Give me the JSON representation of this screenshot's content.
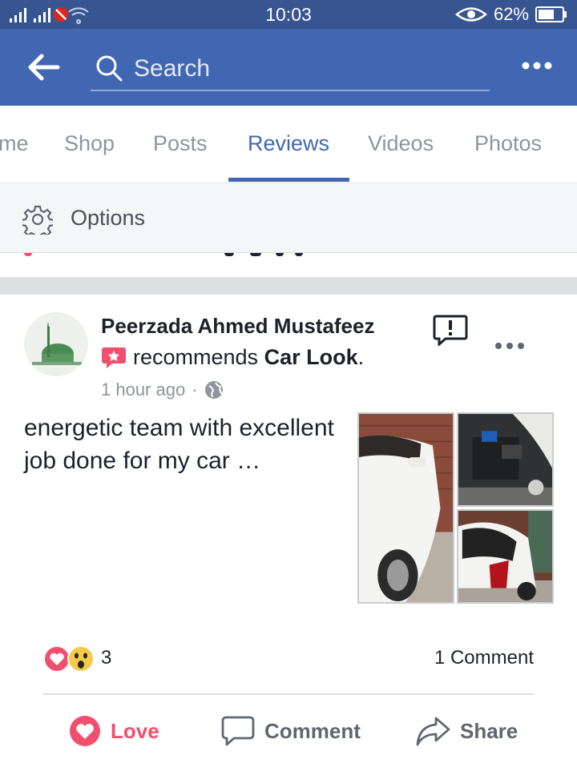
{
  "status_bar": {
    "time": "10:03",
    "battery": "62%"
  },
  "header": {
    "search_placeholder": "Search"
  },
  "tabs": [
    {
      "label": "me"
    },
    {
      "label": "Shop"
    },
    {
      "label": "Posts"
    },
    {
      "label": "Reviews",
      "active": true
    },
    {
      "label": "Videos"
    },
    {
      "label": "Photos"
    }
  ],
  "options": {
    "label": "Options"
  },
  "post": {
    "author": "Peerzada Ahmed Mustafeez",
    "recommends_text": "recommends",
    "page_name": "Car Look",
    "page_suffix": ".",
    "timestamp": "1 hour ago",
    "separator": "·",
    "text": "energetic team with excellent job done for my car …",
    "reactions_count": "3",
    "comments_count": "1 Comment"
  },
  "actions": {
    "love": "Love",
    "comment": "Comment",
    "share": "Share"
  },
  "colors": {
    "status_bar": "#375591",
    "app_bar": "#4267b2",
    "active_tab": "#4267b2",
    "love": "#f0506e",
    "recommend_badge": "#f0506e"
  },
  "icons": [
    "back-arrow-icon",
    "search-icon",
    "more-icon",
    "gear-icon",
    "recommend-badge-icon",
    "globe-icon",
    "report-icon",
    "love-reaction-icon",
    "wow-reaction-icon",
    "heart-icon",
    "comment-icon",
    "share-icon"
  ]
}
